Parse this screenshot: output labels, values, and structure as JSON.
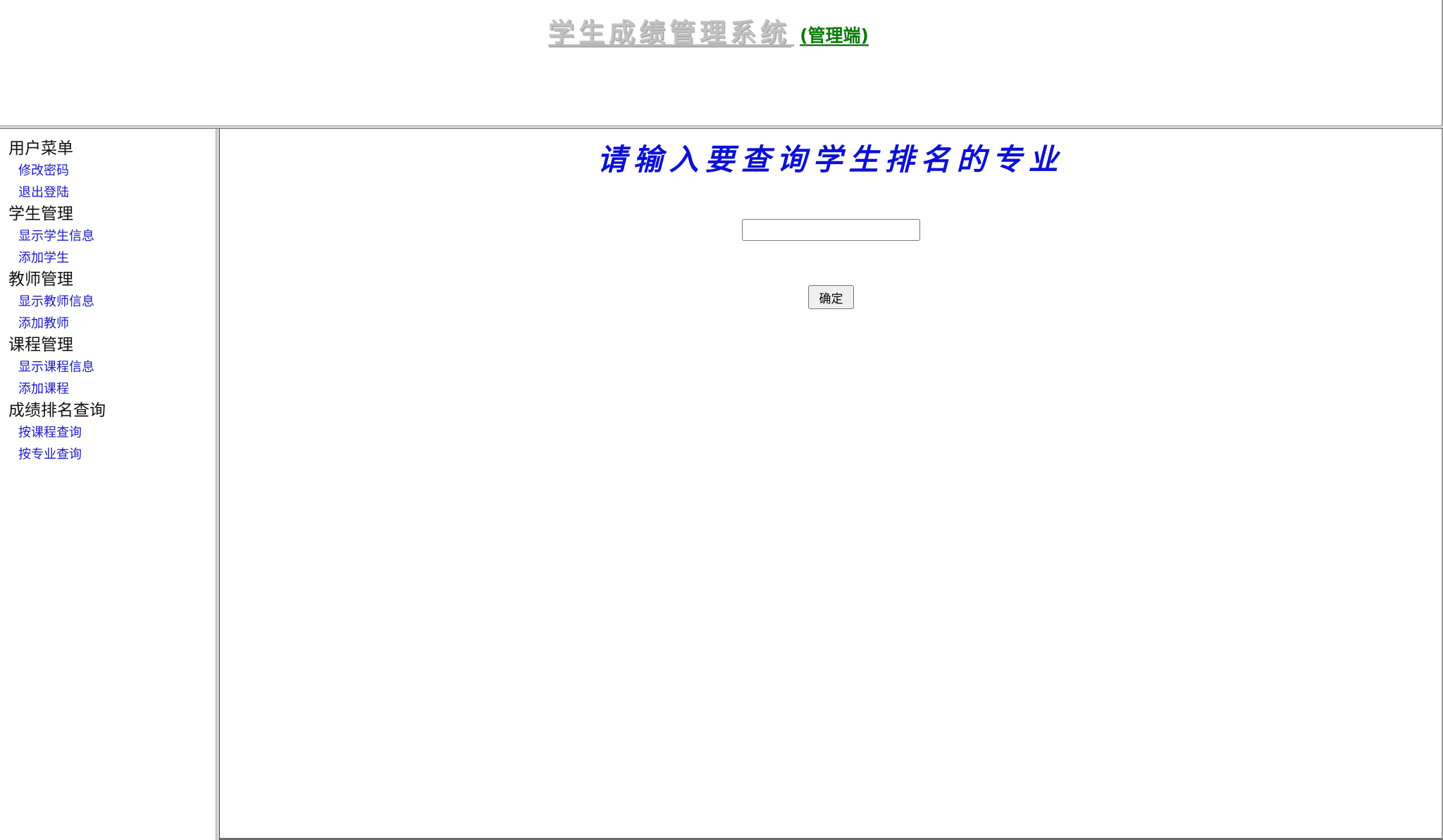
{
  "header": {
    "title": "学生成绩管理系统",
    "spacer": " ",
    "role_label": "(管理端)"
  },
  "sidebar": {
    "groups": [
      {
        "title": "用户菜单",
        "items": [
          {
            "label": "修改密码"
          },
          {
            "label": "退出登陆"
          }
        ]
      },
      {
        "title": "学生管理",
        "items": [
          {
            "label": "显示学生信息"
          },
          {
            "label": "添加学生"
          }
        ]
      },
      {
        "title": "教师管理",
        "items": [
          {
            "label": "显示教师信息"
          },
          {
            "label": "添加教师"
          }
        ]
      },
      {
        "title": "课程管理",
        "items": [
          {
            "label": "显示课程信息"
          },
          {
            "label": "添加课程"
          }
        ]
      },
      {
        "title": "成绩排名查询",
        "items": [
          {
            "label": "按课程查询"
          },
          {
            "label": "按专业查询"
          }
        ]
      }
    ]
  },
  "main": {
    "title": "请输入要查询学生排名的专业",
    "major_input": {
      "value": "",
      "placeholder": ""
    },
    "submit_label": "确定"
  },
  "colors": {
    "title_gray": "#c2c2c2",
    "role_green": "#0a7a0a",
    "link_blue": "#1a1acc",
    "heading_blue": "#0b10d6"
  }
}
